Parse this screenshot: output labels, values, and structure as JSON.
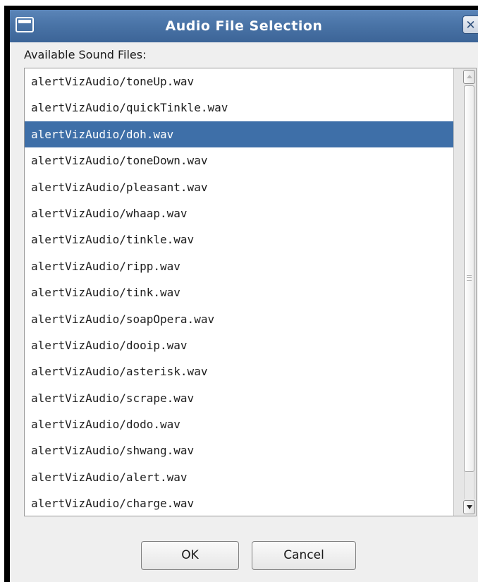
{
  "window": {
    "title": "Audio File Selection",
    "close_glyph": "✕",
    "system_menu_icon": "window-menu-icon",
    "close_icon": "close-icon"
  },
  "main": {
    "list_label": "Available Sound Files:",
    "selected_index": 2,
    "files": [
      "alertVizAudio/toneUp.wav",
      "alertVizAudio/quickTinkle.wav",
      "alertVizAudio/doh.wav",
      "alertVizAudio/toneDown.wav",
      "alertVizAudio/pleasant.wav",
      "alertVizAudio/whaap.wav",
      "alertVizAudio/tinkle.wav",
      "alertVizAudio/ripp.wav",
      "alertVizAudio/tink.wav",
      "alertVizAudio/soapOpera.wav",
      "alertVizAudio/dooip.wav",
      "alertVizAudio/asterisk.wav",
      "alertVizAudio/scrape.wav",
      "alertVizAudio/dodo.wav",
      "alertVizAudio/shwang.wav",
      "alertVizAudio/alert.wav",
      "alertVizAudio/charge.wav"
    ]
  },
  "buttons": {
    "ok_label": "OK",
    "cancel_label": "Cancel"
  },
  "colors": {
    "titlebar": "#4a74a7",
    "selection": "#3e6fa8",
    "dialog_background": "#efefef"
  }
}
